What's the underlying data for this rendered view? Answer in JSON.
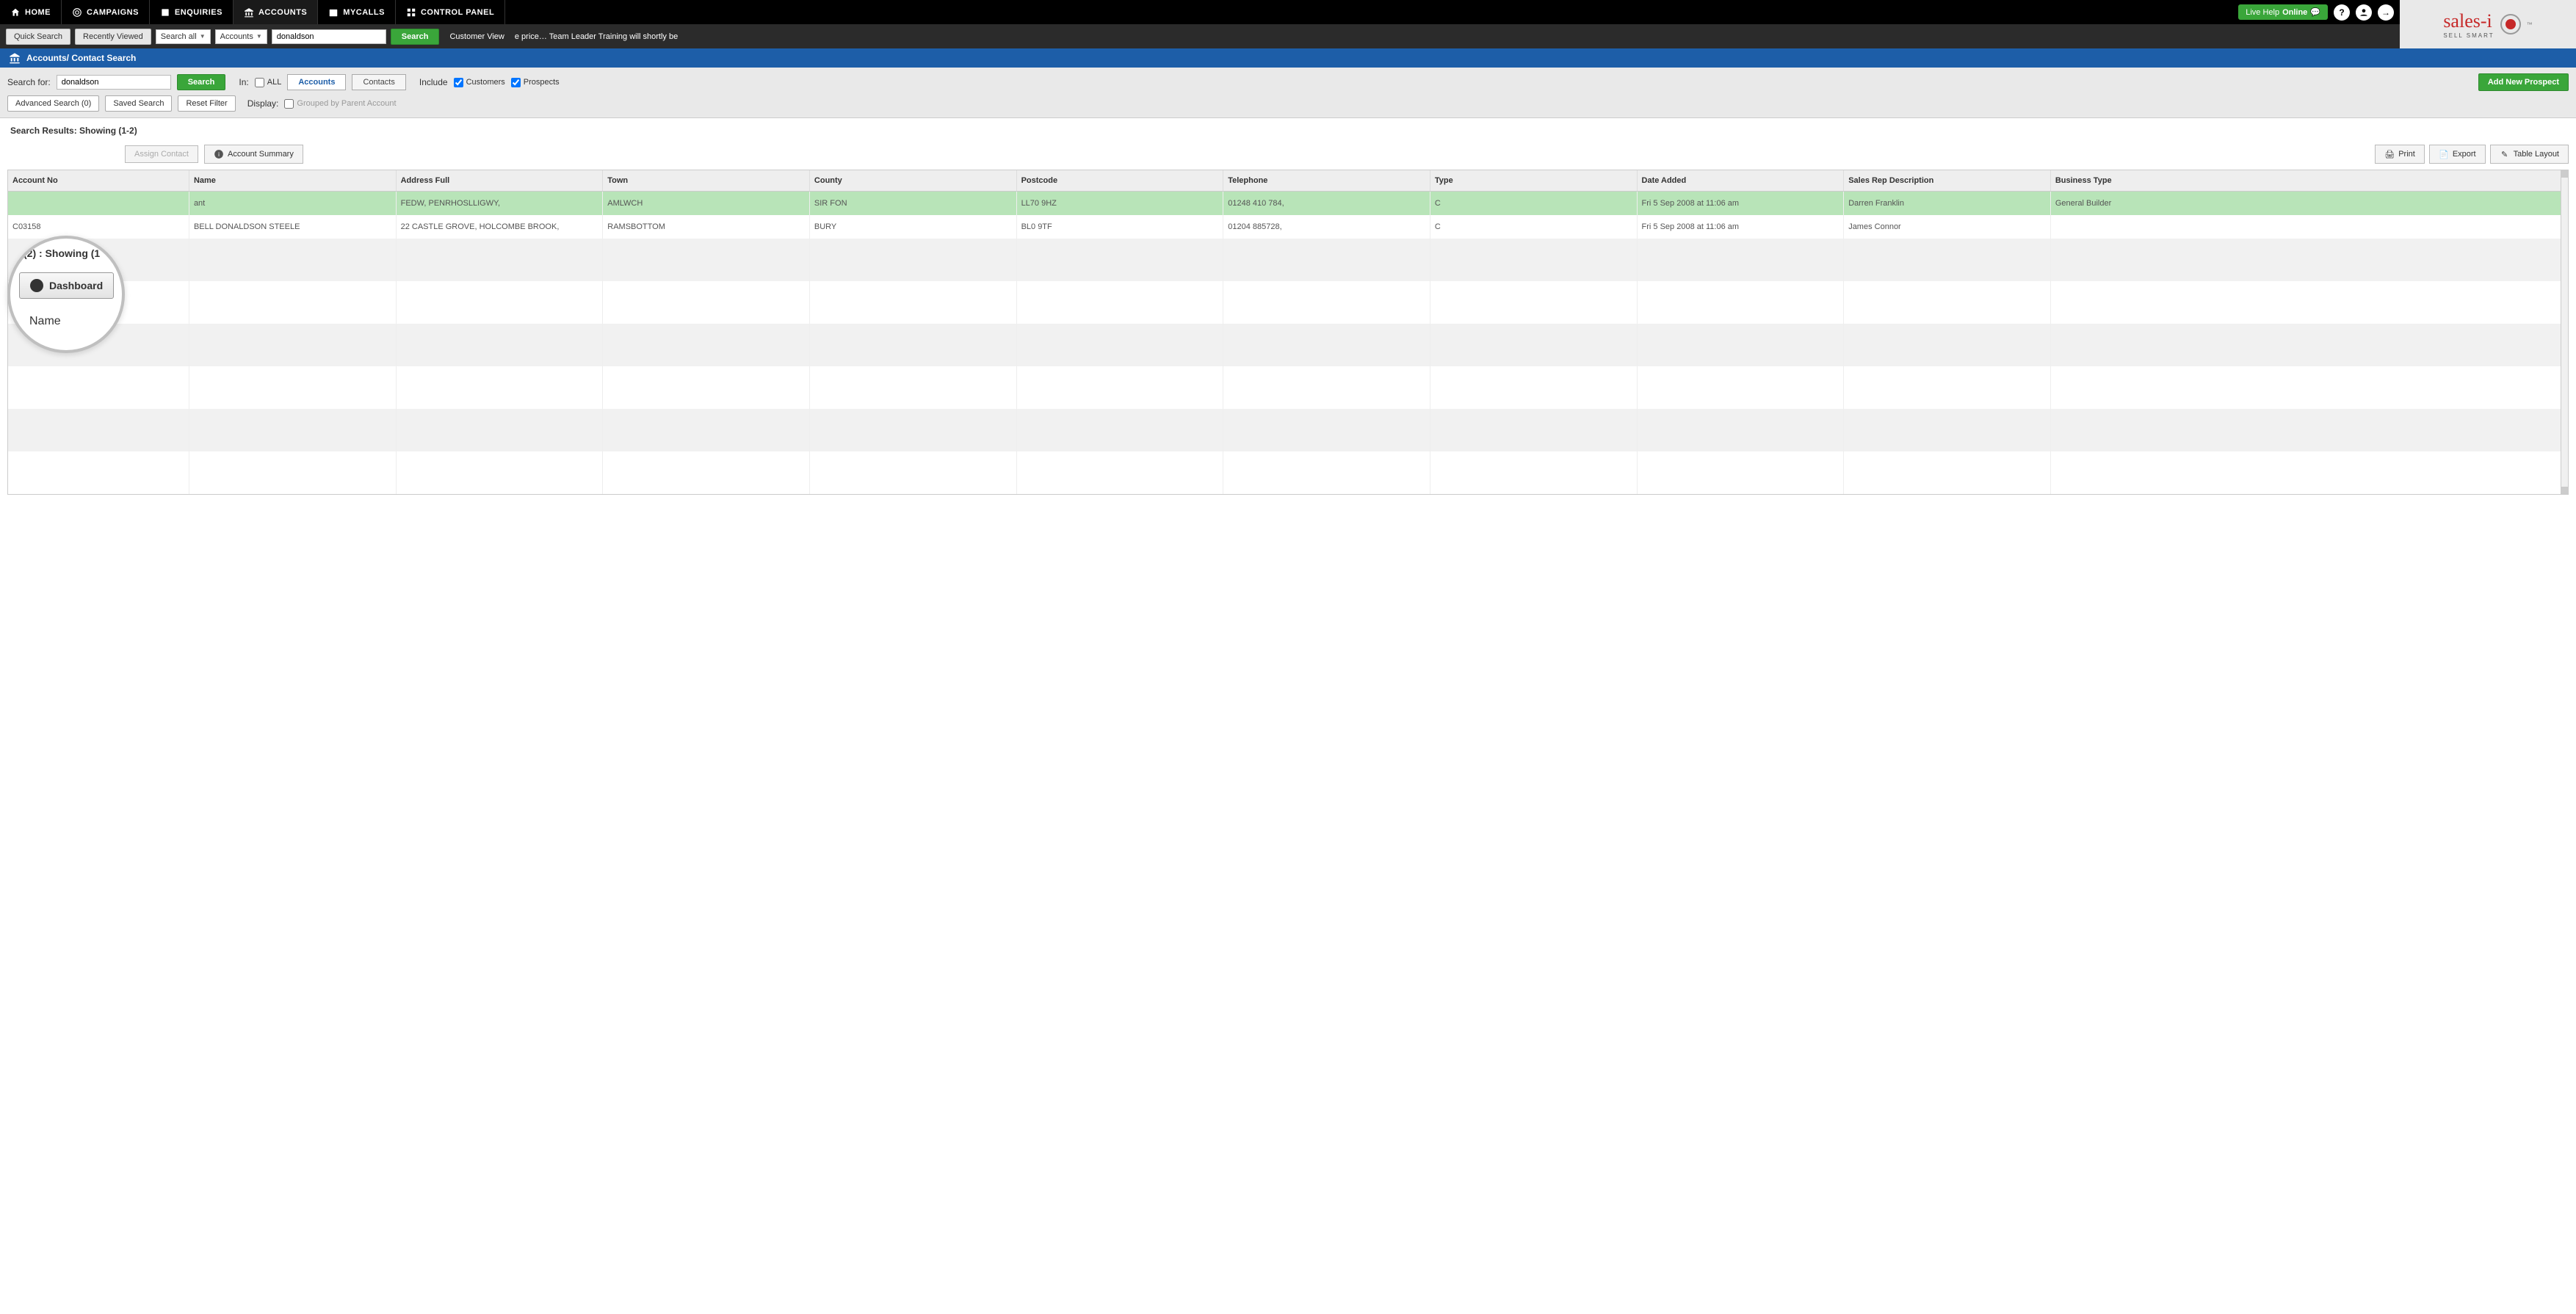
{
  "brand": {
    "name": "sales-i",
    "tagline": "SELL SMART",
    "tm": "™"
  },
  "topnav": {
    "items": [
      {
        "label": "HOME"
      },
      {
        "label": "CAMPAIGNS"
      },
      {
        "label": "ENQUIRIES"
      },
      {
        "label": "ACCOUNTS"
      },
      {
        "label": "MYCALLS"
      },
      {
        "label": "CONTROL PANEL"
      }
    ],
    "live_help_prefix": "Live Help",
    "live_help_status": "Online"
  },
  "secondbar": {
    "quick_search": "Quick Search",
    "recently_viewed": "Recently Viewed",
    "search_all": "Search all",
    "accounts": "Accounts",
    "search_value": "donaldson",
    "search_btn": "Search",
    "customer_view": "Customer View",
    "marquee": "e price… Team Leader Training will shortly be"
  },
  "bluebar": {
    "title": "Accounts/ Contact Search"
  },
  "searchform": {
    "search_for_label": "Search for:",
    "search_for_value": "donaldson",
    "search_btn": "Search",
    "in_label": "In:",
    "all_label": "ALL",
    "accounts_tab": "Accounts",
    "contacts_tab": "Contacts",
    "include_label": "Include",
    "customers_label": "Customers",
    "prospects_label": "Prospects",
    "add_prospect": "Add New Prospect",
    "advanced_search": "Advanced Search (0)",
    "saved_search": "Saved Search",
    "reset_filter": "Reset Filter",
    "display_label": "Display:",
    "grouped_label": "Grouped by Parent Account"
  },
  "results": {
    "title": "Search Results: Showing (1-2)",
    "assign_contact": "Assign Contact",
    "account_summary": "Account Summary",
    "print": "Print",
    "export": "Export",
    "table_layout": "Table Layout",
    "columns": [
      "Account No",
      "Name",
      "Address Full",
      "Town",
      "County",
      "Postcode",
      "Telephone",
      "Type",
      "Date Added",
      "Sales Rep Description",
      "Business Type"
    ],
    "rows": [
      {
        "account_no": "",
        "name": "ant",
        "address": "FEDW, PENRHOSLLIGWY,",
        "town": "AMLWCH",
        "county": "SIR FON",
        "postcode": "LL70 9HZ",
        "telephone": "01248 410 784,",
        "type": "C",
        "date_added": "Fri 5 Sep 2008 at 11:06 am",
        "sales_rep": "Darren Franklin",
        "business_type": "General Builder",
        "selected": true
      },
      {
        "account_no": "C03158",
        "name": "BELL DONALDSON STEELE",
        "address": "22 CASTLE GROVE, HOLCOMBE BROOK,",
        "town": "RAMSBOTTOM",
        "county": "BURY",
        "postcode": "BL0 9TF",
        "telephone": "01204 885728,",
        "type": "C",
        "date_added": "Fri 5 Sep 2008 at 11:06 am",
        "sales_rep": "James Connor",
        "business_type": "",
        "selected": false
      }
    ]
  },
  "magnifier": {
    "showing": "(2) : Showing (1",
    "dashboard": "Dashboard",
    "name_col": "Name"
  },
  "colwidths": [
    "70",
    "80",
    "80",
    "80",
    "80",
    "80",
    "80",
    "80",
    "80",
    "80",
    "200"
  ]
}
